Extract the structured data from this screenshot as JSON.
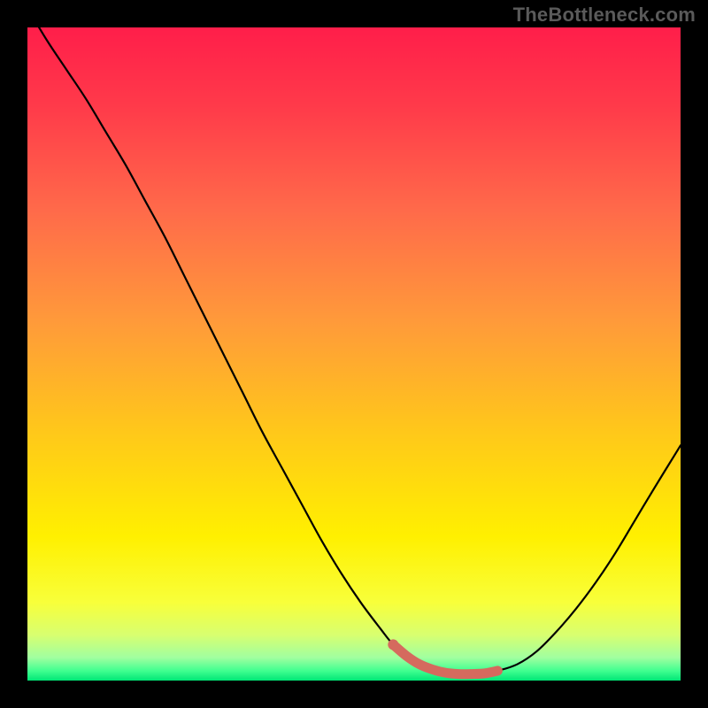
{
  "watermark": "TheBottleneck.com",
  "colors": {
    "curve": "#000000",
    "highlight": "#d56a5e",
    "gradient_stops": [
      {
        "offset": 0.0,
        "color": "#ff1e4a"
      },
      {
        "offset": 0.12,
        "color": "#ff3a4a"
      },
      {
        "offset": 0.28,
        "color": "#ff6a4a"
      },
      {
        "offset": 0.45,
        "color": "#ff9a3a"
      },
      {
        "offset": 0.62,
        "color": "#ffc81a"
      },
      {
        "offset": 0.78,
        "color": "#fff000"
      },
      {
        "offset": 0.88,
        "color": "#f8ff3a"
      },
      {
        "offset": 0.93,
        "color": "#d8ff70"
      },
      {
        "offset": 0.965,
        "color": "#a0ffa0"
      },
      {
        "offset": 0.985,
        "color": "#40ff90"
      },
      {
        "offset": 1.0,
        "color": "#00e676"
      }
    ]
  },
  "chart_data": {
    "type": "line",
    "title": "",
    "xlabel": "",
    "ylabel": "",
    "xlim": [
      0,
      100
    ],
    "ylim": [
      0,
      100
    ],
    "x": [
      0,
      3,
      6,
      9,
      12,
      15,
      18,
      21,
      24,
      27,
      30,
      33,
      36,
      39,
      42,
      45,
      48,
      51,
      54,
      56,
      58,
      60,
      62,
      64,
      66,
      68,
      70,
      72,
      75,
      78,
      81,
      84,
      87,
      90,
      93,
      96,
      100
    ],
    "values": [
      103,
      98,
      93.5,
      89,
      84,
      79,
      73.5,
      68,
      62,
      56,
      50,
      44,
      38,
      32.5,
      27,
      21.5,
      16.5,
      12,
      8,
      5.5,
      3.8,
      2.5,
      1.7,
      1.2,
      1.0,
      1.0,
      1.1,
      1.5,
      2.5,
      4.5,
      7.5,
      11,
      15,
      19.5,
      24.5,
      29.5,
      36
    ],
    "highlight_range_x": [
      56,
      72
    ],
    "annotations": []
  }
}
